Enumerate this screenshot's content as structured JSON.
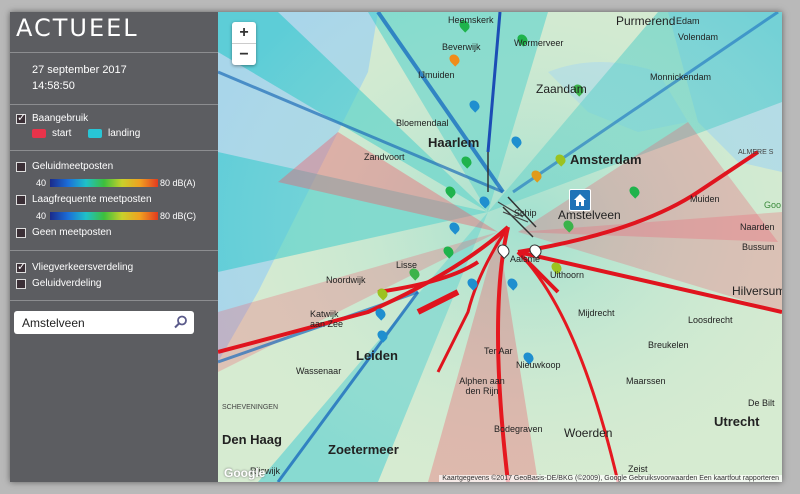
{
  "sidebar": {
    "title": "ACTUEEL",
    "date": "27 september 2017",
    "time": "14:58:50",
    "baangebruik": {
      "label": "Baangebruik",
      "checked": true,
      "start_label": "start",
      "landing_label": "landing",
      "start_color": "#e8334a",
      "landing_color": "#28c6d6"
    },
    "geluidmeetposten": {
      "label": "Geluidmeetposten",
      "scale_min": "40",
      "scale_max": "80 dB(A)"
    },
    "laagfrequent": {
      "label": "Laagfrequente meetposten",
      "scale_min": "40",
      "scale_max": "80 dB(C)"
    },
    "geen": {
      "label": "Geen meetposten"
    },
    "vliegverkeer": {
      "label": "Vliegverkeersverdeling",
      "checked": true
    },
    "geluidverdeling": {
      "label": "Geluidverdeling"
    },
    "search": {
      "value": "Amstelveen",
      "placeholder": ""
    }
  },
  "map": {
    "zoom_in": "+",
    "zoom_out": "−",
    "places": {
      "heemskerk": "Heemskerk",
      "beverwijk": "Beverwijk",
      "wormerveer": "Wormerveer",
      "purmerend": "Purmerend",
      "edam": "Edam",
      "volendam": "Volendam",
      "ijmuiden": "IJmuiden",
      "zaandam": "Zaandam",
      "monnickendam": "Monnickendam",
      "bloemendaal": "Bloemendaal",
      "haarlem": "Haarlem",
      "zandvoort": "Zandvoort",
      "amsterdam": "Amsterdam",
      "almere": "ALMERE S",
      "schiphol": "Schip",
      "amstelveen": "Amstelveen",
      "muiden": "Muiden",
      "naarden": "Naarden",
      "bussum": "Bussum",
      "aalsmeer": "Aalsme",
      "uithoorn": "Uithoorn",
      "lisse": "Lisse",
      "noordwijk": "Noordwijk",
      "katwijk": "Katwijk aan Zee",
      "hilversum": "Hilversum",
      "mijdrecht": "Mijdrecht",
      "loosdrecht": "Loosdrecht",
      "leiden": "Leiden",
      "wassenaar": "Wassenaar",
      "breukelen": "Breukelen",
      "terAar": "Ter Aar",
      "nieuwkoop": "Nieuwkoop",
      "alphen": "Alphen aan den Rijn",
      "maarssen": "Maarssen",
      "scheveningen": "SCHEVENINGEN",
      "denhaag": "Den Haag",
      "utrecht": "Utrecht",
      "debilt": "De Bilt",
      "zoetermeer": "Zoetermeer",
      "woerden": "Woerden",
      "bodegraven": "Bodegraven",
      "rijswijk": "Rijswijk",
      "zeist": "Zeist",
      "goo": "Goo"
    },
    "google": "Google",
    "attribution": "Kaartgegevens ©2017 GeoBasis-DE/BKG (©2009), Google   Gebruiksvoorwaarden   Een kaartfout rapporteren"
  }
}
